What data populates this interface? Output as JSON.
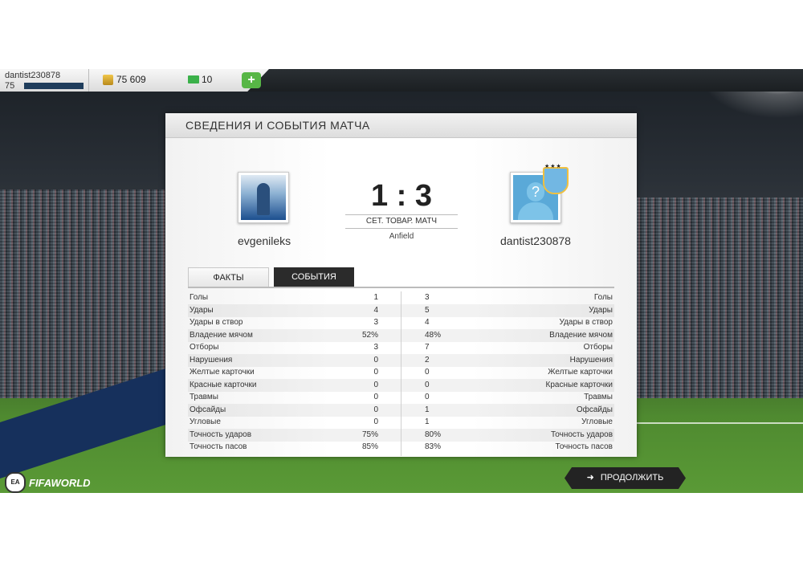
{
  "topbar": {
    "username": "dantist230878",
    "level": "75",
    "coins": "75 609",
    "points": "10",
    "add_label": "+"
  },
  "panel": {
    "title": "СВЕДЕНИЯ И СОБЫТИЯ МАТЧА"
  },
  "match": {
    "home_name": "evgenileks",
    "away_name": "dantist230878",
    "score": "1 : 3",
    "type": "СЕТ. ТОВАР. МАТЧ",
    "stadium": "Anfield"
  },
  "tabs": {
    "facts": "ФАКТЫ",
    "events": "СОБЫТИЯ"
  },
  "stats": [
    {
      "label": "Голы",
      "home": "1",
      "away": "3"
    },
    {
      "label": "Удары",
      "home": "4",
      "away": "5"
    },
    {
      "label": "Удары в створ",
      "home": "3",
      "away": "4"
    },
    {
      "label": "Владение мячом",
      "home": "52%",
      "away": "48%"
    },
    {
      "label": "Отборы",
      "home": "3",
      "away": "7"
    },
    {
      "label": "Нарушения",
      "home": "0",
      "away": "2"
    },
    {
      "label": "Желтые карточки",
      "home": "0",
      "away": "0"
    },
    {
      "label": "Красные карточки",
      "home": "0",
      "away": "0"
    },
    {
      "label": "Травмы",
      "home": "0",
      "away": "0"
    },
    {
      "label": "Офсайды",
      "home": "0",
      "away": "1"
    },
    {
      "label": "Угловые",
      "home": "0",
      "away": "1"
    },
    {
      "label": "Точность ударов",
      "home": "75%",
      "away": "80%"
    },
    {
      "label": "Точность пасов",
      "home": "85%",
      "away": "83%"
    }
  ],
  "footer": {
    "ea_label": "EA SPORTS",
    "brand": "FIFAWORLD",
    "continue_label": "ПРОДОЛЖИТЬ"
  },
  "icons": {
    "coins": "coin-icon",
    "points": "points-icon",
    "continue": "arrow-right-icon"
  },
  "colors": {
    "accent_green": "#57b646",
    "dark_button": "#232323"
  }
}
